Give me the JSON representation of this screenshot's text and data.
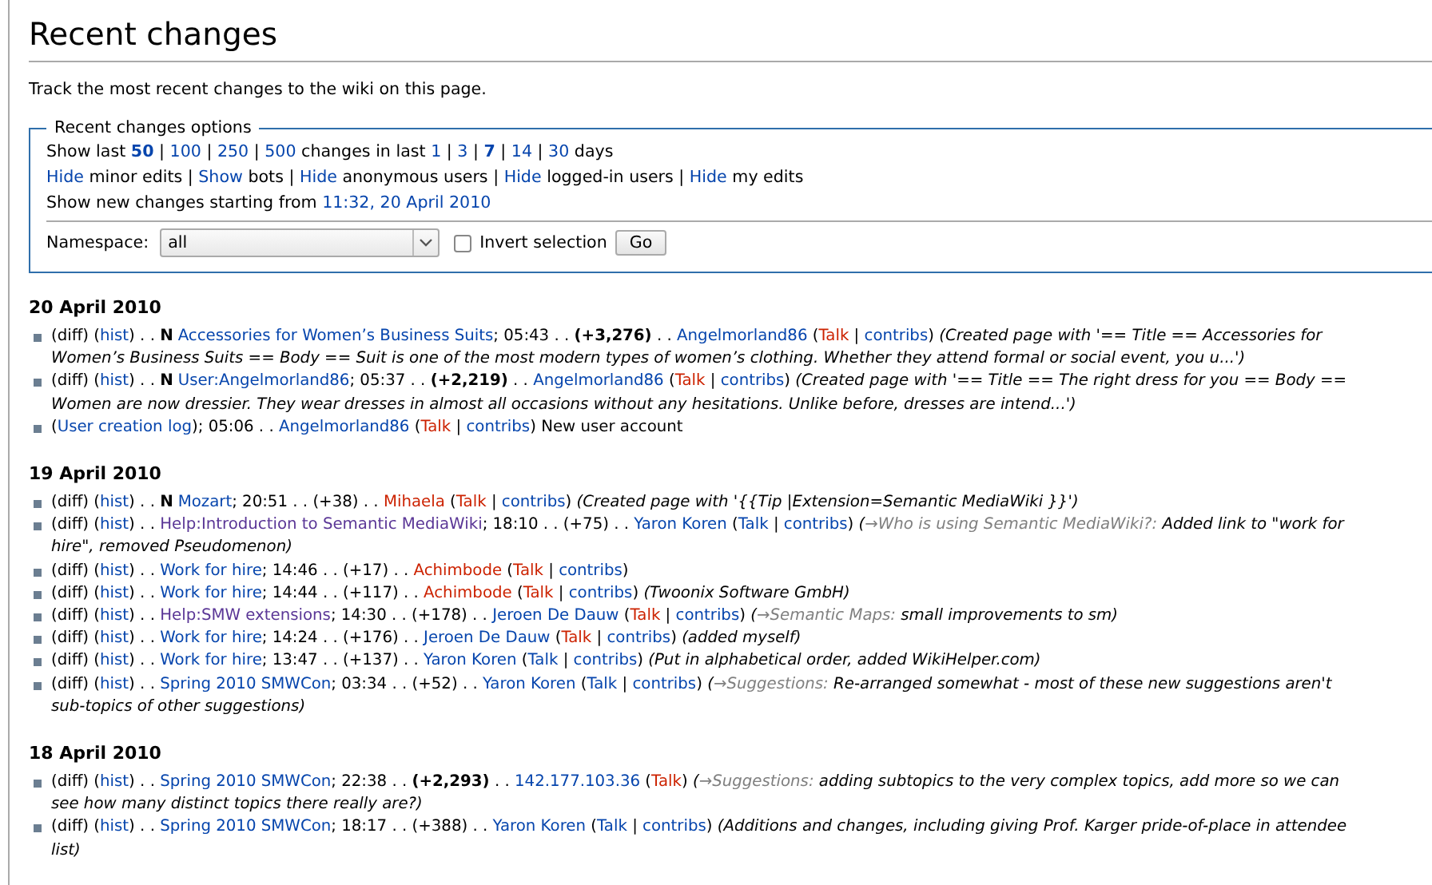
{
  "title": "Recent changes",
  "intro": "Track the most recent changes to the wiki on this page.",
  "options": {
    "legend": "Recent changes options",
    "lines": [
      [
        {
          "kind": "text",
          "text": "Show last "
        },
        {
          "kind": "current",
          "text": "50"
        },
        {
          "kind": "text",
          "text": " | "
        },
        {
          "kind": "link",
          "text": "100"
        },
        {
          "kind": "text",
          "text": " | "
        },
        {
          "kind": "link",
          "text": "250"
        },
        {
          "kind": "text",
          "text": " | "
        },
        {
          "kind": "link",
          "text": "500"
        },
        {
          "kind": "text",
          "text": " changes in last "
        },
        {
          "kind": "link",
          "text": "1"
        },
        {
          "kind": "text",
          "text": " | "
        },
        {
          "kind": "link",
          "text": "3"
        },
        {
          "kind": "text",
          "text": " | "
        },
        {
          "kind": "current",
          "text": "7"
        },
        {
          "kind": "text",
          "text": " | "
        },
        {
          "kind": "link",
          "text": "14"
        },
        {
          "kind": "text",
          "text": " | "
        },
        {
          "kind": "link",
          "text": "30"
        },
        {
          "kind": "text",
          "text": " days"
        }
      ],
      [
        {
          "kind": "link",
          "text": "Hide"
        },
        {
          "kind": "text",
          "text": " minor edits | "
        },
        {
          "kind": "link",
          "text": "Show"
        },
        {
          "kind": "text",
          "text": " bots | "
        },
        {
          "kind": "link",
          "text": "Hide"
        },
        {
          "kind": "text",
          "text": " anonymous users | "
        },
        {
          "kind": "link",
          "text": "Hide"
        },
        {
          "kind": "text",
          "text": " logged-in users | "
        },
        {
          "kind": "link",
          "text": "Hide"
        },
        {
          "kind": "text",
          "text": " my edits"
        }
      ],
      [
        {
          "kind": "text",
          "text": "Show new changes starting from "
        },
        {
          "kind": "link",
          "text": "11:32, 20 April 2010"
        }
      ]
    ],
    "namespace_label": "Namespace:",
    "namespace_value": "all",
    "invert": {
      "label": "Invert selection",
      "checked": false
    },
    "button": "Go"
  },
  "days": [
    {
      "date": "20 April 2010",
      "entries": [
        {
          "lines": [
            [
              {
                "kind": "text",
                "text": "(diff) ("
              },
              {
                "kind": "link",
                "text": "hist"
              },
              {
                "kind": "text",
                "text": ") . . "
              },
              {
                "kind": "flag",
                "text": "N"
              },
              {
                "kind": "link",
                "text": "Accessories for Women’s Business Suits"
              },
              {
                "kind": "text",
                "text": "; 05:43 . . "
              },
              {
                "kind": "bigsize",
                "text": "(+3,276)"
              },
              {
                "kind": "text",
                "text": " . . "
              },
              {
                "kind": "link",
                "text": "Angelmorland86"
              },
              {
                "kind": "text",
                "text": " ("
              },
              {
                "kind": "new",
                "text": "Talk"
              },
              {
                "kind": "text",
                "text": " | "
              },
              {
                "kind": "link",
                "text": "contribs"
              },
              {
                "kind": "text",
                "text": ") "
              },
              {
                "kind": "comment",
                "text": "(Created page with '== Title == Accessories for"
              }
            ],
            [
              {
                "kind": "comment",
                "text": "Women’s Business Suits == Body == Suit is one of the most modern types of women’s clothing. Whether they attend formal or social event, you u...')"
              }
            ]
          ]
        },
        {
          "lines": [
            [
              {
                "kind": "text",
                "text": "(diff) ("
              },
              {
                "kind": "link",
                "text": "hist"
              },
              {
                "kind": "text",
                "text": ") . . "
              },
              {
                "kind": "flag",
                "text": "N"
              },
              {
                "kind": "link",
                "text": "User:Angelmorland86"
              },
              {
                "kind": "text",
                "text": "; 05:37 . . "
              },
              {
                "kind": "bigsize",
                "text": "(+2,219)"
              },
              {
                "kind": "text",
                "text": " . . "
              },
              {
                "kind": "link",
                "text": "Angelmorland86"
              },
              {
                "kind": "text",
                "text": " ("
              },
              {
                "kind": "new",
                "text": "Talk"
              },
              {
                "kind": "text",
                "text": " | "
              },
              {
                "kind": "link",
                "text": "contribs"
              },
              {
                "kind": "text",
                "text": ") "
              },
              {
                "kind": "comment",
                "text": "(Created page with '== Title == The right dress for you == Body =="
              }
            ],
            [
              {
                "kind": "comment",
                "text": "Women are now dressier. They wear dresses in almost all occasions without any hesitations. Unlike before, dresses are intend...')"
              }
            ]
          ]
        },
        {
          "lines": [
            [
              {
                "kind": "text",
                "text": "("
              },
              {
                "kind": "link",
                "text": "User creation log"
              },
              {
                "kind": "text",
                "text": "); 05:06 . . "
              },
              {
                "kind": "link",
                "text": "Angelmorland86"
              },
              {
                "kind": "text",
                "text": " ("
              },
              {
                "kind": "new",
                "text": "Talk"
              },
              {
                "kind": "text",
                "text": " | "
              },
              {
                "kind": "link",
                "text": "contribs"
              },
              {
                "kind": "text",
                "text": ") New user account"
              }
            ]
          ]
        }
      ]
    },
    {
      "date": "19 April 2010",
      "entries": [
        {
          "lines": [
            [
              {
                "kind": "text",
                "text": "(diff) ("
              },
              {
                "kind": "link",
                "text": "hist"
              },
              {
                "kind": "text",
                "text": ") . . "
              },
              {
                "kind": "flag",
                "text": "N"
              },
              {
                "kind": "link",
                "text": "Mozart"
              },
              {
                "kind": "text",
                "text": "; 20:51 . . (+38) . . "
              },
              {
                "kind": "new",
                "text": "Mihaela"
              },
              {
                "kind": "text",
                "text": " ("
              },
              {
                "kind": "new",
                "text": "Talk"
              },
              {
                "kind": "text",
                "text": " | "
              },
              {
                "kind": "link",
                "text": "contribs"
              },
              {
                "kind": "text",
                "text": ") "
              },
              {
                "kind": "comment",
                "text": "(Created page with '{{Tip |Extension=Semantic MediaWiki }}')"
              }
            ]
          ]
        },
        {
          "lines": [
            [
              {
                "kind": "text",
                "text": "(diff) ("
              },
              {
                "kind": "link",
                "text": "hist"
              },
              {
                "kind": "text",
                "text": ") . . "
              },
              {
                "kind": "visited",
                "text": "Help:Introduction to Semantic MediaWiki"
              },
              {
                "kind": "text",
                "text": "; 18:10 . . (+75) . . "
              },
              {
                "kind": "link",
                "text": "Yaron Koren"
              },
              {
                "kind": "text",
                "text": " ("
              },
              {
                "kind": "link",
                "text": "Talk"
              },
              {
                "kind": "text",
                "text": " | "
              },
              {
                "kind": "link",
                "text": "contribs"
              },
              {
                "kind": "text",
                "text": ") "
              },
              {
                "kind": "comment",
                "text": "("
              },
              {
                "kind": "section",
                "text": "→Who is using Semantic MediaWiki?:"
              },
              {
                "kind": "comment",
                "text": " Added link to \"work for"
              }
            ],
            [
              {
                "kind": "comment",
                "text": "hire\", removed Pseudomenon)"
              }
            ]
          ]
        },
        {
          "lines": [
            [
              {
                "kind": "text",
                "text": "(diff) ("
              },
              {
                "kind": "link",
                "text": "hist"
              },
              {
                "kind": "text",
                "text": ") . . "
              },
              {
                "kind": "link",
                "text": "Work for hire"
              },
              {
                "kind": "text",
                "text": "; 14:46 . . (+17) . . "
              },
              {
                "kind": "new",
                "text": "Achimbode"
              },
              {
                "kind": "text",
                "text": " ("
              },
              {
                "kind": "new",
                "text": "Talk"
              },
              {
                "kind": "text",
                "text": " | "
              },
              {
                "kind": "link",
                "text": "contribs"
              },
              {
                "kind": "text",
                "text": ")"
              }
            ]
          ]
        },
        {
          "lines": [
            [
              {
                "kind": "text",
                "text": "(diff) ("
              },
              {
                "kind": "link",
                "text": "hist"
              },
              {
                "kind": "text",
                "text": ") . . "
              },
              {
                "kind": "link",
                "text": "Work for hire"
              },
              {
                "kind": "text",
                "text": "; 14:44 . . (+117) . . "
              },
              {
                "kind": "new",
                "text": "Achimbode"
              },
              {
                "kind": "text",
                "text": " ("
              },
              {
                "kind": "new",
                "text": "Talk"
              },
              {
                "kind": "text",
                "text": " | "
              },
              {
                "kind": "link",
                "text": "contribs"
              },
              {
                "kind": "text",
                "text": ") "
              },
              {
                "kind": "comment",
                "text": "(Twoonix Software GmbH)"
              }
            ]
          ]
        },
        {
          "lines": [
            [
              {
                "kind": "text",
                "text": "(diff) ("
              },
              {
                "kind": "link",
                "text": "hist"
              },
              {
                "kind": "text",
                "text": ") . . "
              },
              {
                "kind": "visited",
                "text": "Help:SMW extensions"
              },
              {
                "kind": "text",
                "text": "; 14:30 . . (+178) . . "
              },
              {
                "kind": "link",
                "text": "Jeroen De Dauw"
              },
              {
                "kind": "text",
                "text": " ("
              },
              {
                "kind": "new",
                "text": "Talk"
              },
              {
                "kind": "text",
                "text": " | "
              },
              {
                "kind": "link",
                "text": "contribs"
              },
              {
                "kind": "text",
                "text": ") "
              },
              {
                "kind": "comment",
                "text": "("
              },
              {
                "kind": "section",
                "text": "→Semantic Maps:"
              },
              {
                "kind": "comment",
                "text": " small improvements to sm)"
              }
            ]
          ]
        },
        {
          "lines": [
            [
              {
                "kind": "text",
                "text": "(diff) ("
              },
              {
                "kind": "link",
                "text": "hist"
              },
              {
                "kind": "text",
                "text": ") . . "
              },
              {
                "kind": "link",
                "text": "Work for hire"
              },
              {
                "kind": "text",
                "text": "; 14:24 . . (+176) . . "
              },
              {
                "kind": "link",
                "text": "Jeroen De Dauw"
              },
              {
                "kind": "text",
                "text": " ("
              },
              {
                "kind": "new",
                "text": "Talk"
              },
              {
                "kind": "text",
                "text": " | "
              },
              {
                "kind": "link",
                "text": "contribs"
              },
              {
                "kind": "text",
                "text": ") "
              },
              {
                "kind": "comment",
                "text": "(added myself)"
              }
            ]
          ]
        },
        {
          "lines": [
            [
              {
                "kind": "text",
                "text": "(diff) ("
              },
              {
                "kind": "link",
                "text": "hist"
              },
              {
                "kind": "text",
                "text": ") . . "
              },
              {
                "kind": "link",
                "text": "Work for hire"
              },
              {
                "kind": "text",
                "text": "; 13:47 . . (+137) . . "
              },
              {
                "kind": "link",
                "text": "Yaron Koren"
              },
              {
                "kind": "text",
                "text": " ("
              },
              {
                "kind": "link",
                "text": "Talk"
              },
              {
                "kind": "text",
                "text": " | "
              },
              {
                "kind": "link",
                "text": "contribs"
              },
              {
                "kind": "text",
                "text": ") "
              },
              {
                "kind": "comment",
                "text": "(Put in alphabetical order, added WikiHelper.com)"
              }
            ]
          ]
        },
        {
          "lines": [
            [
              {
                "kind": "text",
                "text": "(diff) ("
              },
              {
                "kind": "link",
                "text": "hist"
              },
              {
                "kind": "text",
                "text": ") . . "
              },
              {
                "kind": "link",
                "text": "Spring 2010 SMWCon"
              },
              {
                "kind": "text",
                "text": "; 03:34 . . (+52) . . "
              },
              {
                "kind": "link",
                "text": "Yaron Koren"
              },
              {
                "kind": "text",
                "text": " ("
              },
              {
                "kind": "link",
                "text": "Talk"
              },
              {
                "kind": "text",
                "text": " | "
              },
              {
                "kind": "link",
                "text": "contribs"
              },
              {
                "kind": "text",
                "text": ") "
              },
              {
                "kind": "comment",
                "text": "("
              },
              {
                "kind": "section",
                "text": "→Suggestions:"
              },
              {
                "kind": "comment",
                "text": " Re-arranged somewhat - most of these new suggestions aren't"
              }
            ],
            [
              {
                "kind": "comment",
                "text": "sub-topics of other suggestions)"
              }
            ]
          ]
        }
      ]
    },
    {
      "date": "18 April 2010",
      "entries": [
        {
          "lines": [
            [
              {
                "kind": "text",
                "text": "(diff) ("
              },
              {
                "kind": "link",
                "text": "hist"
              },
              {
                "kind": "text",
                "text": ") . . "
              },
              {
                "kind": "link",
                "text": "Spring 2010 SMWCon"
              },
              {
                "kind": "text",
                "text": "; 22:38 . . "
              },
              {
                "kind": "bigsize",
                "text": "(+2,293)"
              },
              {
                "kind": "text",
                "text": " . . "
              },
              {
                "kind": "link",
                "text": "142.177.103.36"
              },
              {
                "kind": "text",
                "text": " ("
              },
              {
                "kind": "new",
                "text": "Talk"
              },
              {
                "kind": "text",
                "text": ") "
              },
              {
                "kind": "comment",
                "text": "("
              },
              {
                "kind": "section",
                "text": "→Suggestions:"
              },
              {
                "kind": "comment",
                "text": " adding subtopics to the very complex topics, add more so we can"
              }
            ],
            [
              {
                "kind": "comment",
                "text": "see how many distinct topics there really are?)"
              }
            ]
          ]
        },
        {
          "lines": [
            [
              {
                "kind": "text",
                "text": "(diff) ("
              },
              {
                "kind": "link",
                "text": "hist"
              },
              {
                "kind": "text",
                "text": ") . . "
              },
              {
                "kind": "link",
                "text": "Spring 2010 SMWCon"
              },
              {
                "kind": "text",
                "text": "; 18:17 . . (+388) . . "
              },
              {
                "kind": "link",
                "text": "Yaron Koren"
              },
              {
                "kind": "text",
                "text": " ("
              },
              {
                "kind": "link",
                "text": "Talk"
              },
              {
                "kind": "text",
                "text": " | "
              },
              {
                "kind": "link",
                "text": "contribs"
              },
              {
                "kind": "text",
                "text": ") "
              },
              {
                "kind": "comment",
                "text": "(Additions and changes, including giving Prof. Karger pride-of-place in attendee"
              }
            ],
            [
              {
                "kind": "comment",
                "text": "list)"
              }
            ]
          ]
        }
      ]
    }
  ]
}
